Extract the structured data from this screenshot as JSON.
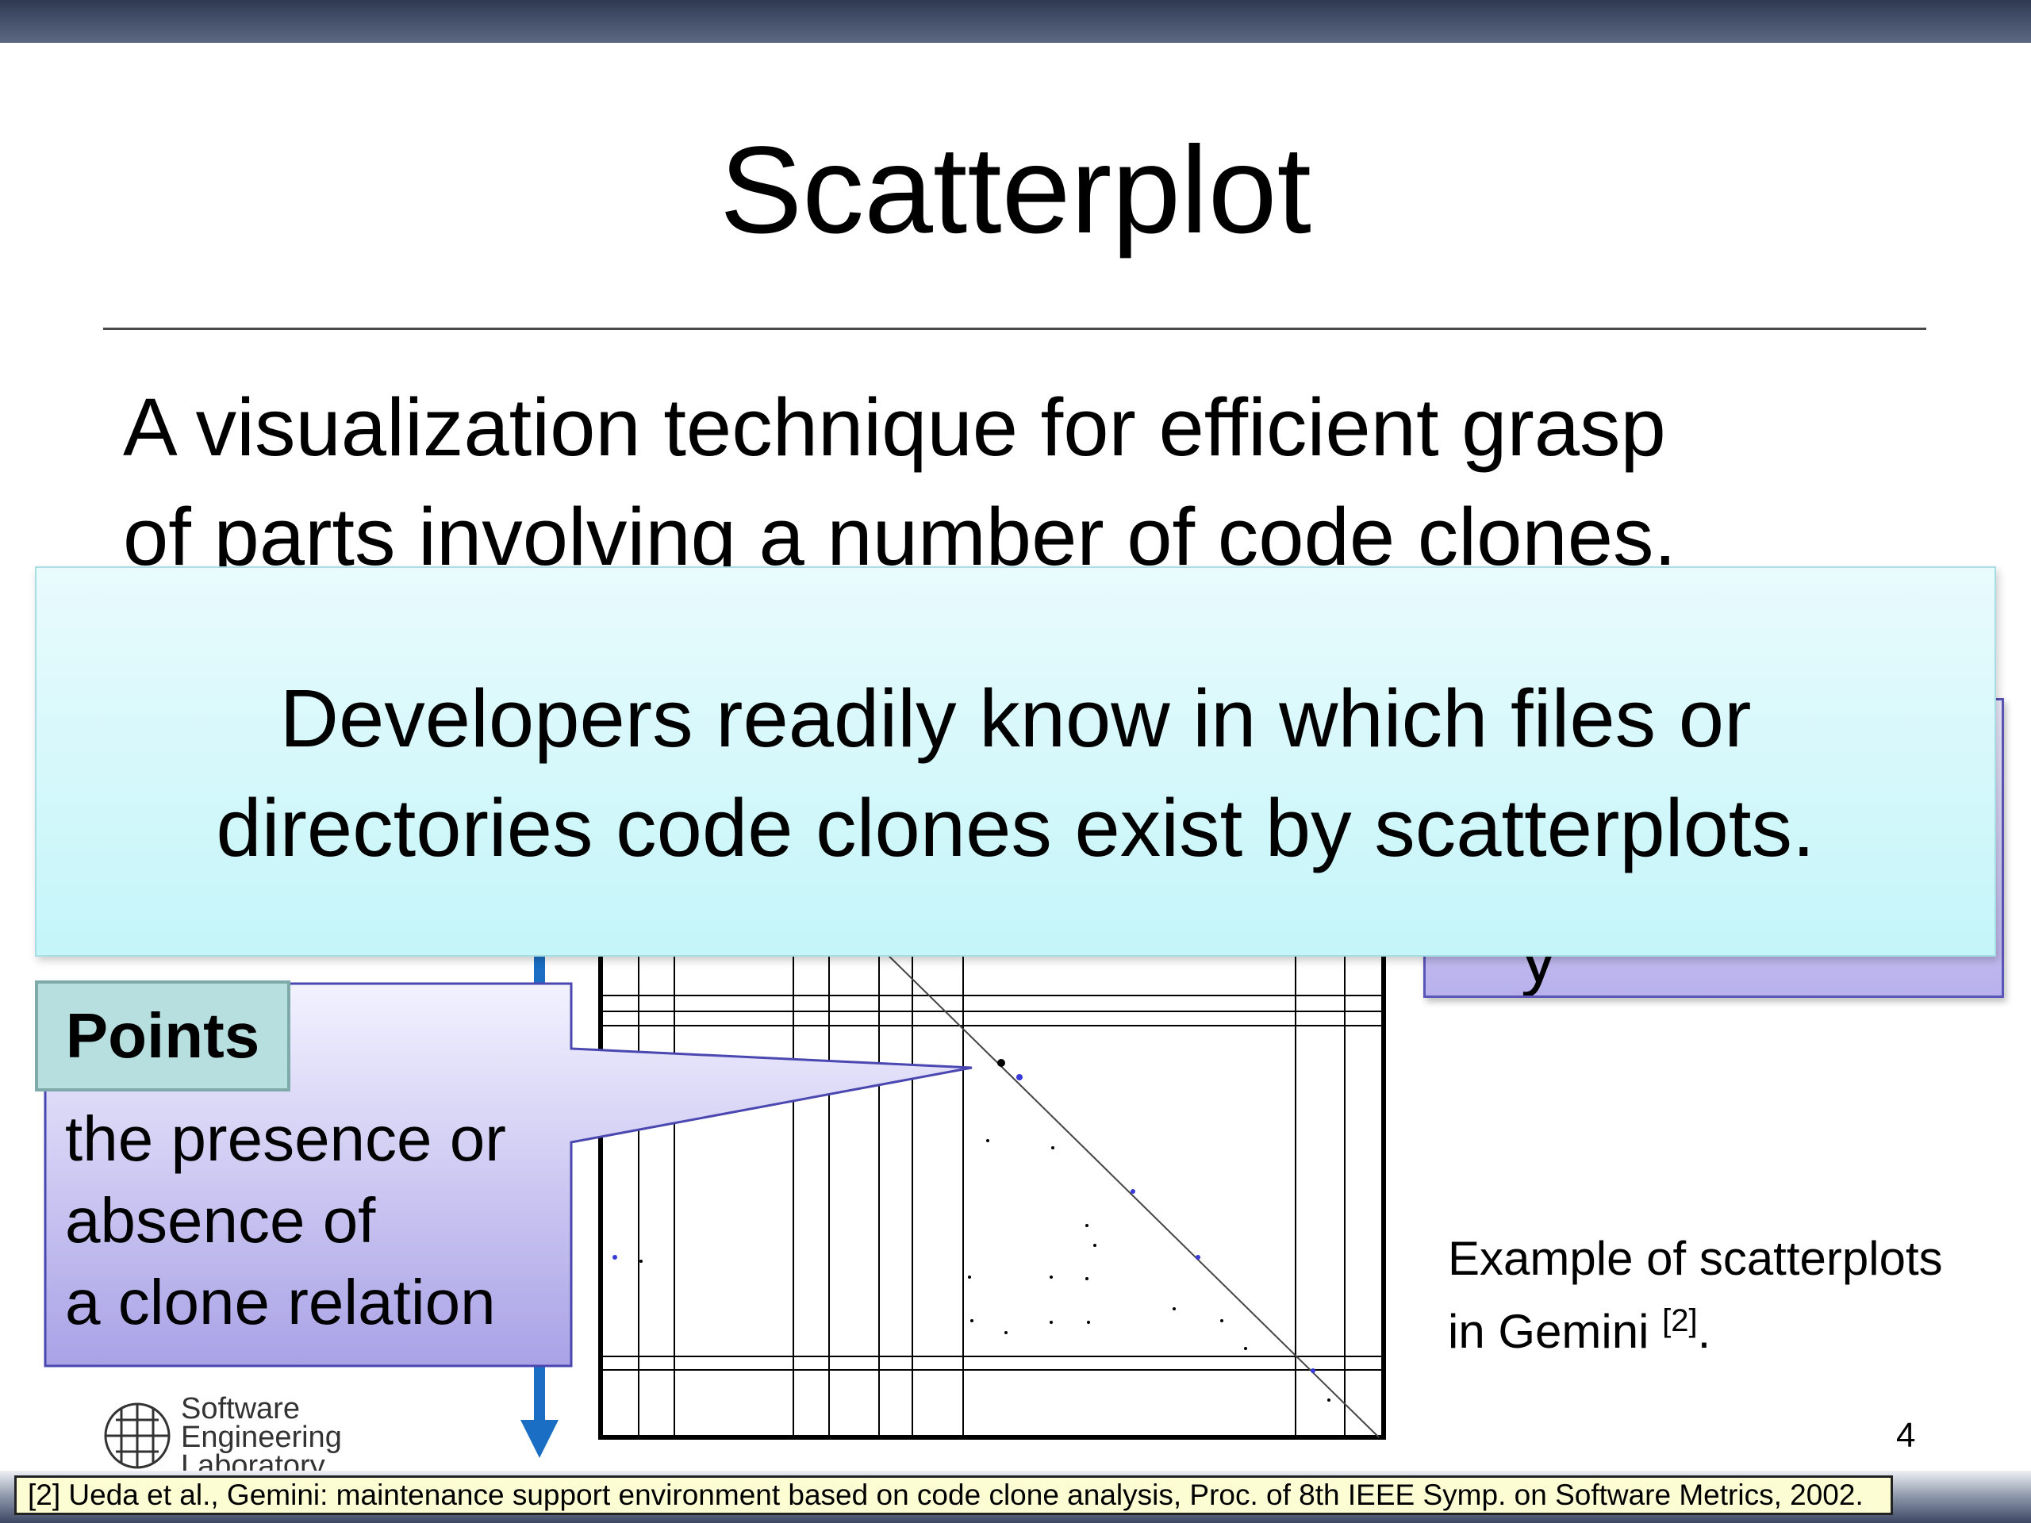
{
  "slide": {
    "title": "Scatterplot",
    "intro_line1": "A visualization technique for efficient grasp",
    "intro_line2": "of parts involving a number of code clones.",
    "message_line1": "Developers readily know in which files or",
    "message_line2": "directories code clones exist by scatterplots.",
    "right_callout_visible_text": "y",
    "points_title": "Points",
    "points_line1": "the presence or",
    "points_line2": "absence of",
    "points_line3": "a clone relation",
    "caption_line1": "Example of scatterplots",
    "caption_line2": "in Gemini ",
    "caption_ref": "[2]",
    "caption_end": ".",
    "page_number": "4",
    "footnote": "[2] Ueda et al., Gemini: maintenance support environment based on code clone analysis, Proc. of 8th IEEE Symp. on Software Metrics, 2002."
  },
  "logo": {
    "line1": "Software",
    "line2": "Engineering",
    "line3": "Laboratory"
  },
  "colors": {
    "top_bar": "#3e4862",
    "message_box": "#d4f8fb",
    "callout": "#c6c0f0",
    "arrow": "#1a6fc4",
    "footnote_bg": "#fdfdd3"
  }
}
